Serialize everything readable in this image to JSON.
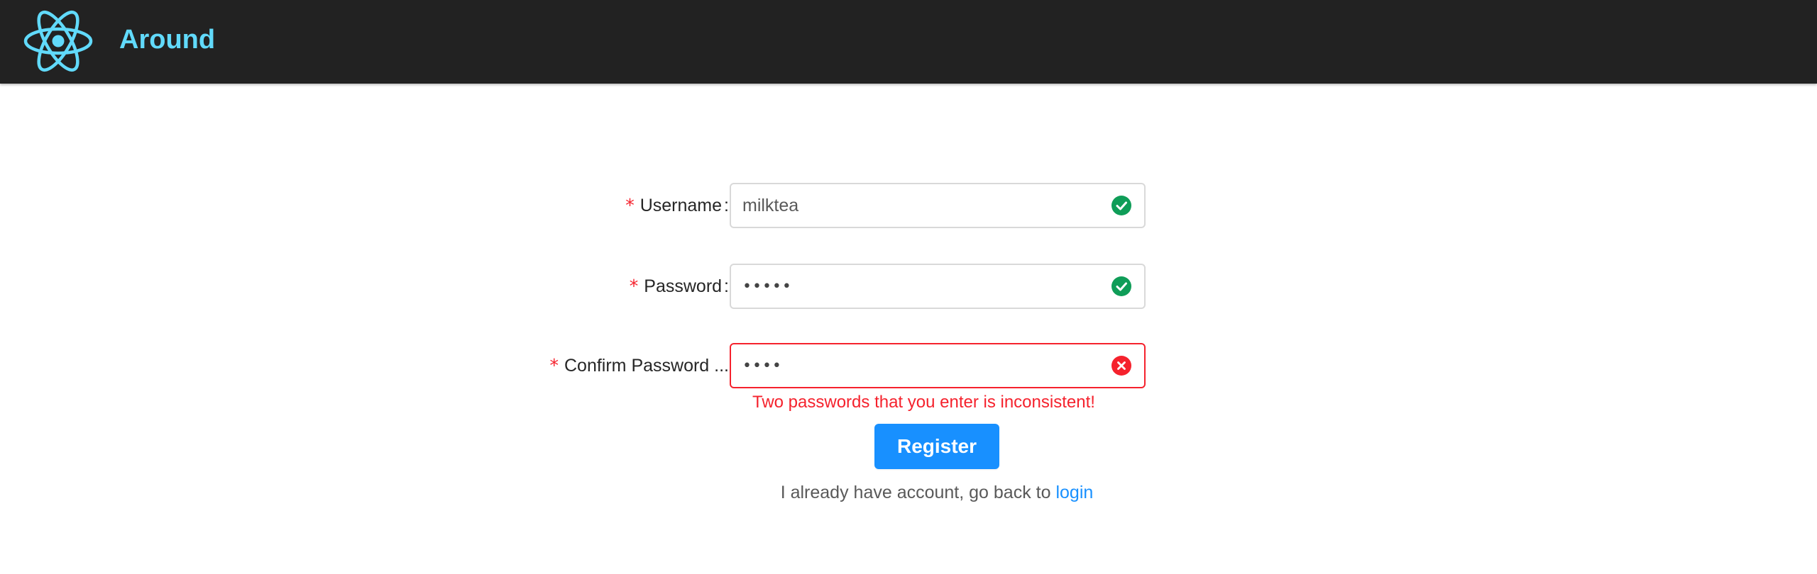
{
  "header": {
    "logo_icon": "react-atom-icon",
    "title": "Around",
    "accent_color": "#61dafb",
    "background_color": "#222222"
  },
  "form": {
    "fields": [
      {
        "label": "Username",
        "required": true,
        "value": "milktea",
        "status": "success",
        "status_icon": "check-circle-icon"
      },
      {
        "label": "Password",
        "required": true,
        "value": "•••••",
        "status": "success",
        "status_icon": "check-circle-icon"
      },
      {
        "label": "Confirm Password ...",
        "required": true,
        "value": "••••",
        "status": "error",
        "status_icon": "close-circle-icon",
        "error_message": "Two passwords that you enter is inconsistent!"
      }
    ],
    "required_marker": "*",
    "colon": ":",
    "submit_label": "Register",
    "submit_color": "#1890ff",
    "error_color": "#f5222d",
    "success_color": "#0f9d58"
  },
  "footer": {
    "text": "I already have account, go back to ",
    "link_label": "login"
  }
}
